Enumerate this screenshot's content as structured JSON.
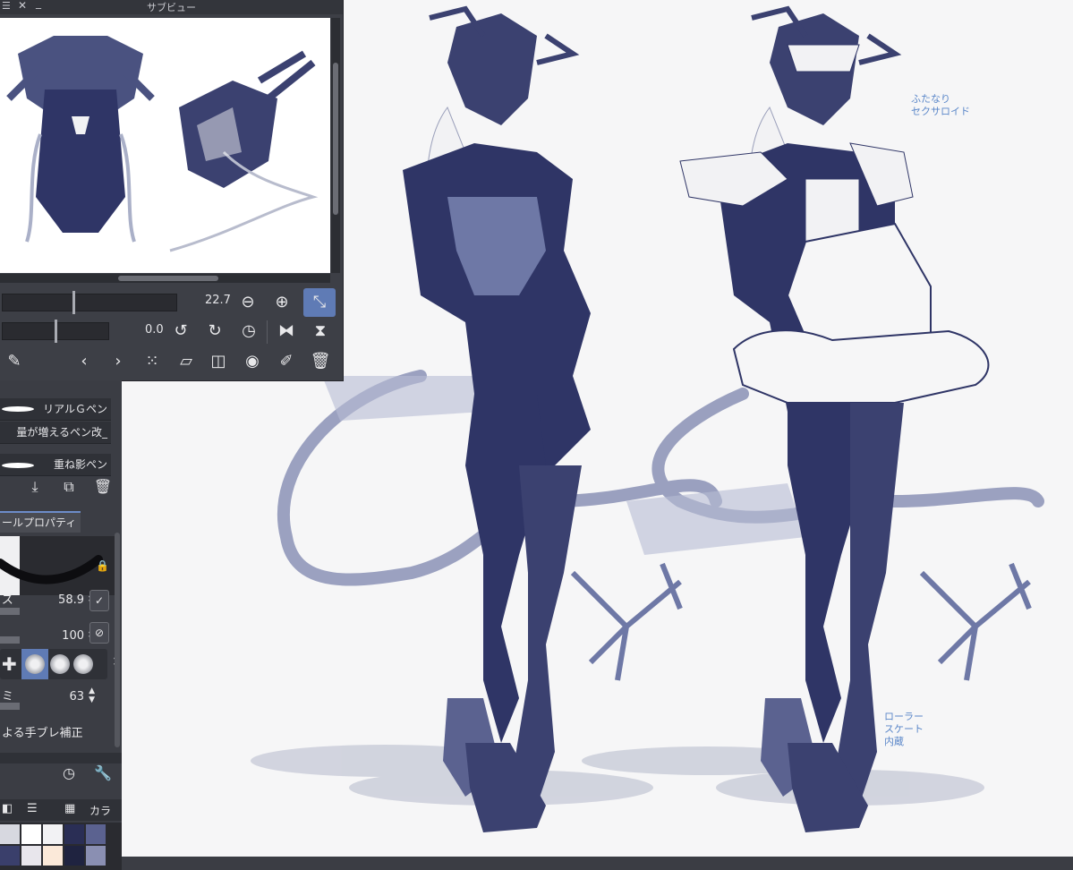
{
  "subview": {
    "title": "サブビュー",
    "zoom_value": "22.7",
    "rotate_value": "0.0"
  },
  "brush_list": [
    {
      "label": "リアルＧペン"
    },
    {
      "label": "量が増えるペン改_"
    },
    {
      "label": "重ね影ペン"
    }
  ],
  "tool_property": {
    "tab_label": "ールプロパティ",
    "size_label": "ズ",
    "size_value": "58.9",
    "opacity_value": "100",
    "stabilization_label": "ミ",
    "stabilization_value": "63",
    "correction_label": "よる手ブレ補正"
  },
  "bottom_tabs": {
    "color_label": "カラ"
  },
  "annotations": {
    "note1": "ふたなり\nセクサロイド",
    "note2": "ローラー\nスケート\n内蔵"
  },
  "colors": {
    "accent": "#5f7bb5",
    "panel": "#3b3d44",
    "figure_dark": "#2f3566",
    "figure_mid": "#6e78a6",
    "annotation": "#5b87c9"
  },
  "swatches": [
    "#d7d8e0",
    "#ffffff",
    "#f2f2f4",
    "#2a2e55",
    "#5b6290",
    "#3a3f6b",
    "#e8e6ec",
    "#fbe9d9",
    "#1f2340",
    "#8a8fb2"
  ]
}
